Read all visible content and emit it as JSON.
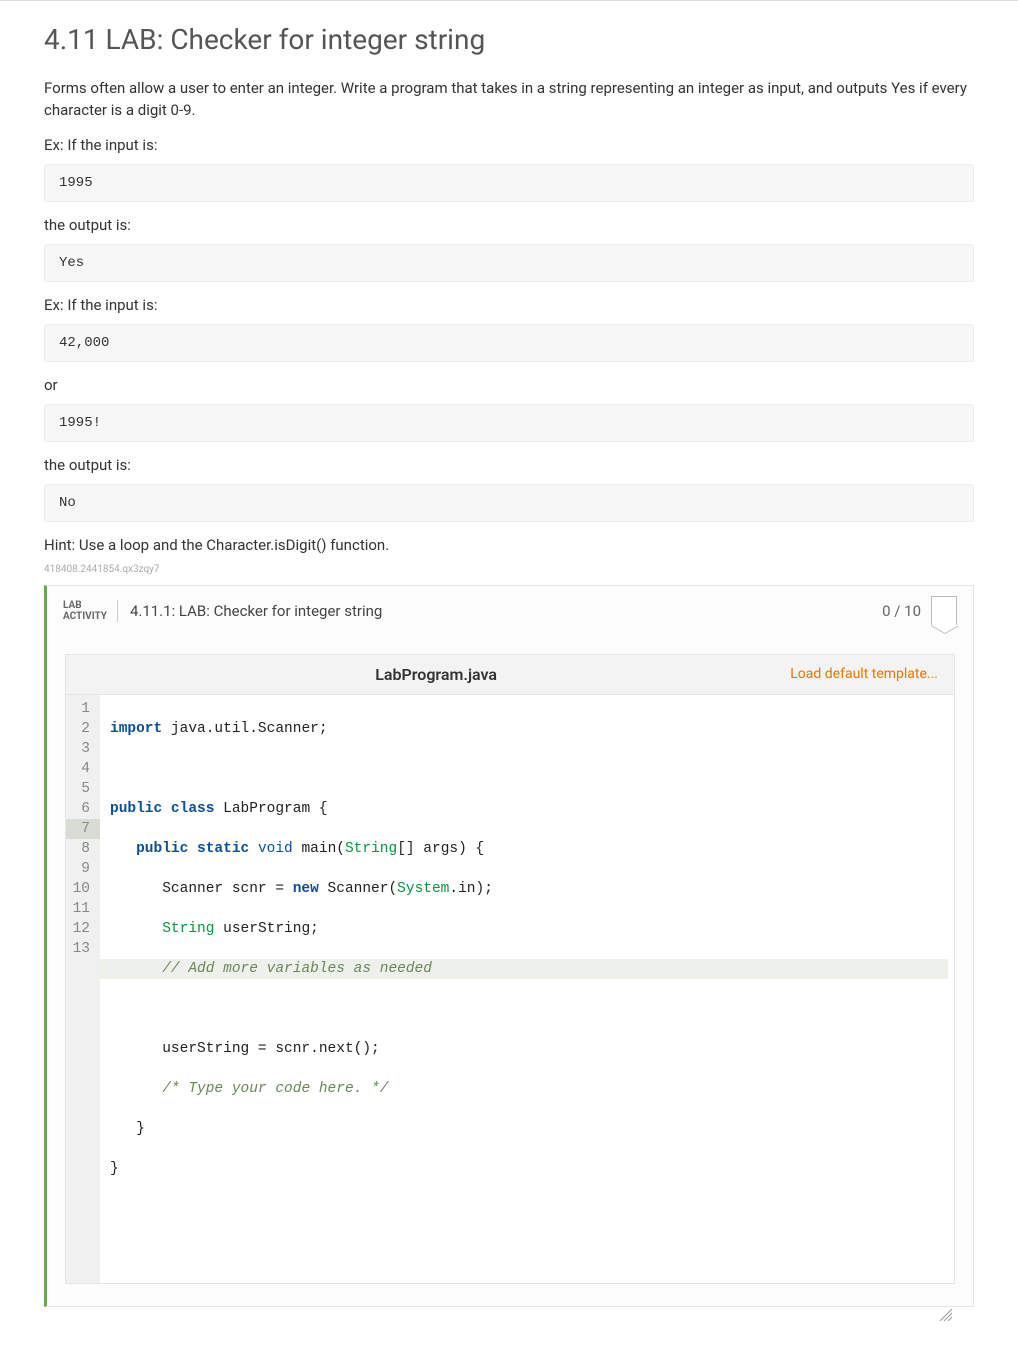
{
  "title": "4.11 LAB: Checker for integer string",
  "intro": "Forms often allow a user to enter an integer. Write a program that takes in a string representing an integer as input, and outputs Yes if every character is a digit 0-9.",
  "ex1_label": "Ex: If the input is:",
  "io_input1": "1995",
  "output_label": "the output is:",
  "io_output1": "Yes",
  "ex2_label": "Ex: If the input is:",
  "io_input2": "42,000",
  "or_label": "or",
  "io_input3": "1995!",
  "output_label2": "the output is:",
  "io_output2": "No",
  "hint": "Hint: Use a loop and the Character.isDigit() function.",
  "small_id": "418408.2441854.qx3zqy7",
  "activity": {
    "label_line1": "LAB",
    "label_line2": "ACTIVITY",
    "title": "4.11.1: LAB: Checker for integer string",
    "score": "0 / 10"
  },
  "editor": {
    "filename": "LabProgram.java",
    "load_template": "Load default template...",
    "line_count": 13
  }
}
